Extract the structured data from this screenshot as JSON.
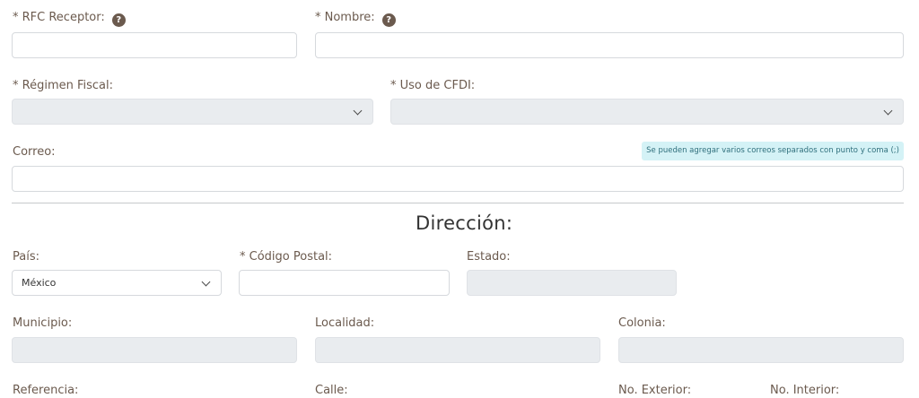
{
  "receptor": {
    "rfc_label": "* RFC Receptor:",
    "rfc_value": "",
    "nombre_label": "* Nombre:",
    "nombre_value": "",
    "help_glyph": "?",
    "regimen_label": "* Régimen Fiscal:",
    "regimen_value": "",
    "uso_label": "* Uso de CFDI:",
    "uso_value": "",
    "correo_label": "Correo:",
    "correo_value": "",
    "correo_hint": "Se pueden agregar varios correos separados con punto y coma (;)"
  },
  "direccion": {
    "title": "Dirección:",
    "pais_label": "País:",
    "pais_value": "México",
    "cp_label": "* Código Postal:",
    "cp_value": "",
    "estado_label": "Estado:",
    "municipio_label": "Municipio:",
    "localidad_label": "Localidad:",
    "colonia_label": "Colonia:",
    "referencia_label": "Referencia:",
    "calle_label": "Calle:",
    "no_exterior_label": "No. Exterior:",
    "no_interior_label": "No. Interior:"
  },
  "colors": {
    "label": "#6b5a4e",
    "input_border": "#d6d9dd",
    "disabled_bg": "#e9ecef",
    "hint_bg": "#d4f2f6",
    "hint_text": "#2f6f7c"
  },
  "icons": {
    "help": "question-circle-icon",
    "chevron": "chevron-down-icon"
  }
}
